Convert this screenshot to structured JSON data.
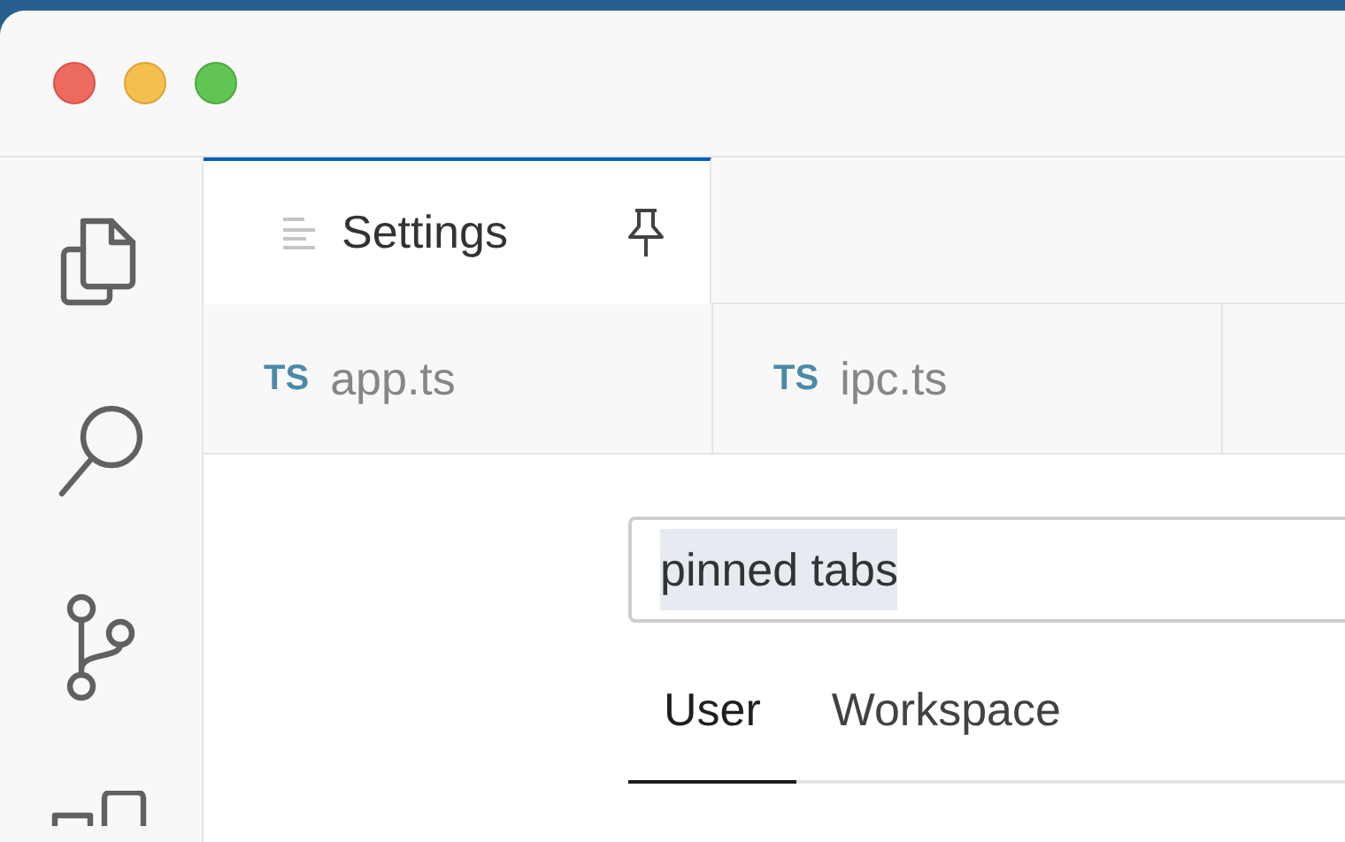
{
  "activity_bar": {
    "items": [
      {
        "kind": "files",
        "selected": false
      },
      {
        "kind": "search",
        "selected": false
      },
      {
        "kind": "source-control",
        "selected": false
      },
      {
        "kind": "extensions",
        "selected": false
      }
    ]
  },
  "pinned_tabs": [
    {
      "label": "Settings",
      "kind": "settings",
      "selected": true,
      "pinned": true
    }
  ],
  "tabs": [
    {
      "label": "app.ts",
      "badge": "TS",
      "selected": false
    },
    {
      "label": "ipc.ts",
      "badge": "TS",
      "selected": false
    }
  ],
  "search": {
    "value": "pinned tabs",
    "text_selected": true
  },
  "scope_tabs": [
    {
      "label": "User",
      "selected": true
    },
    {
      "label": "Workspace",
      "selected": false
    }
  ]
}
